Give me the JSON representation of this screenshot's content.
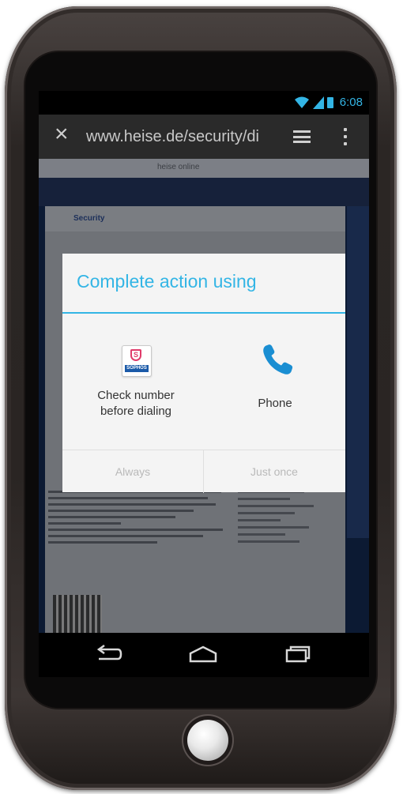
{
  "status_bar": {
    "time": "6:08",
    "icons": [
      "wifi-icon",
      "signal-icon",
      "battery-icon"
    ],
    "accent_color": "#33b5e5"
  },
  "browser": {
    "url": "www.heise.de/security/di",
    "close_icon": "close-icon",
    "tabs_icon": "menu-lines-icon",
    "overflow_icon": "overflow-dots-icon"
  },
  "webpage": {
    "top_strip_text": "heise online",
    "logo_text": "Security"
  },
  "dialog": {
    "title": "Complete action using",
    "options": [
      {
        "label_line1": "Check number",
        "label_line2": "before dialing",
        "icon": "sophos-icon",
        "icon_text": "SOPHOS",
        "shield_letter": "S"
      },
      {
        "label": "Phone",
        "icon": "phone-icon"
      }
    ],
    "buttons": {
      "always": "Always",
      "just_once": "Just once"
    },
    "colors": {
      "title": "#33b5e5",
      "background": "#f4f4f4",
      "disabled_text": "#b9b9b9"
    }
  },
  "nav_bar": {
    "icons": [
      "back-icon",
      "home-icon",
      "recent-apps-icon"
    ]
  }
}
